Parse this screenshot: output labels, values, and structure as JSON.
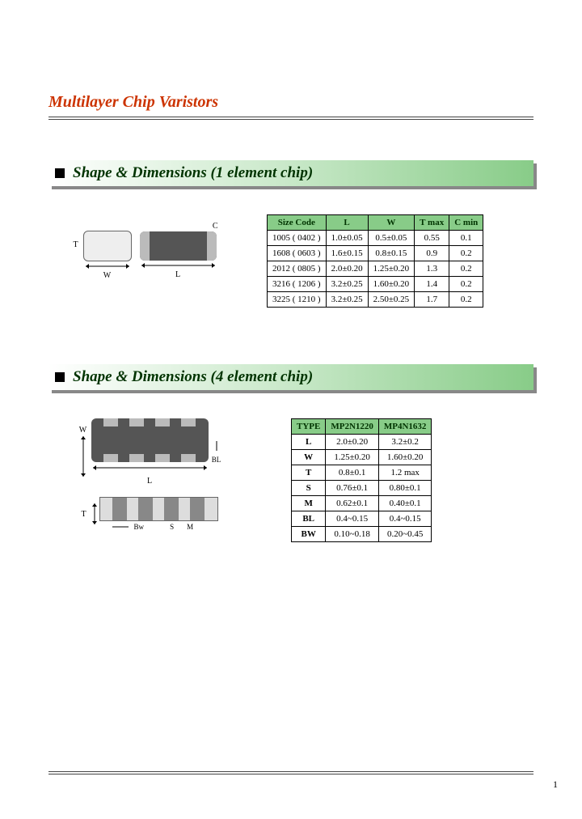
{
  "title": "Multilayer Chip Varistors",
  "page_number": "1",
  "section1": {
    "heading": "Shape  &  Dimensions  (1 element chip)",
    "labels": {
      "W": "W",
      "L": "L",
      "T": "T",
      "C": "C"
    },
    "table": {
      "headers": [
        "Size Code",
        "L",
        "W",
        "T max",
        "C min"
      ],
      "rows": [
        [
          "1005 ( 0402 )",
          "1.0±0.05",
          "0.5±0.05",
          "0.55",
          "0.1"
        ],
        [
          "1608 ( 0603 )",
          "1.6±0.15",
          "0.8±0.15",
          "0.9",
          "0.2"
        ],
        [
          "2012 ( 0805 )",
          "2.0±0.20",
          "1.25±0.20",
          "1.3",
          "0.2"
        ],
        [
          "3216 ( 1206 )",
          "3.2±0.25",
          "1.60±0.20",
          "1.4",
          "0.2"
        ],
        [
          "3225 ( 1210 )",
          "3.2±0.25",
          "2.50±0.25",
          "1.7",
          "0.2"
        ]
      ]
    }
  },
  "section2": {
    "heading": "Shape & Dimensions (4 element chip)",
    "labels": {
      "W": "W",
      "L": "L",
      "T": "T",
      "BL": "BL",
      "Bw": "Bw",
      "S": "S",
      "M": "M"
    },
    "table": {
      "headers": [
        "TYPE",
        "MP2N1220",
        "MP4N1632"
      ],
      "rows": [
        [
          "L",
          "2.0±0.20",
          "3.2±0.2"
        ],
        [
          "W",
          "1.25±0.20",
          "1.60±0.20"
        ],
        [
          "T",
          "0.8±0.1",
          "1.2 max"
        ],
        [
          "S",
          "0.76±0.1",
          "0.80±0.1"
        ],
        [
          "M",
          "0.62±0.1",
          "0.40±0.1"
        ],
        [
          "BL",
          "0.4~0.15",
          "0.4~0.15"
        ],
        [
          "BW",
          "0.10~0.18",
          "0.20~0.45"
        ]
      ]
    }
  }
}
